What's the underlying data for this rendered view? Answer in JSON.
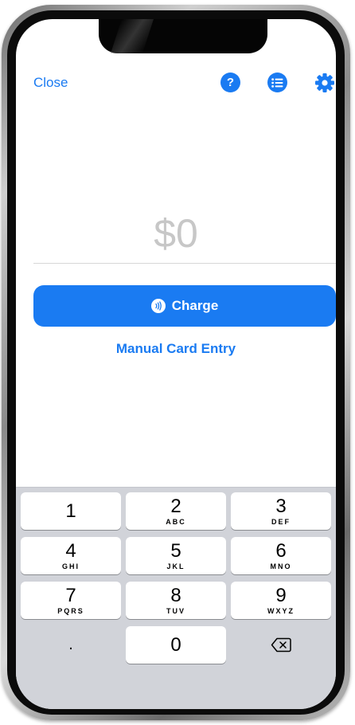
{
  "topbar": {
    "close_label": "Close",
    "help_icon_glyph": "?",
    "icons": [
      "help-icon",
      "list-icon",
      "gear-icon"
    ]
  },
  "amount": {
    "value": "$0"
  },
  "actions": {
    "charge_label": "Charge",
    "manual_label": "Manual Card Entry"
  },
  "keypad": {
    "keys": [
      {
        "digit": "1",
        "letters": ""
      },
      {
        "digit": "2",
        "letters": "ABC"
      },
      {
        "digit": "3",
        "letters": "DEF"
      },
      {
        "digit": "4",
        "letters": "GHI"
      },
      {
        "digit": "5",
        "letters": "JKL"
      },
      {
        "digit": "6",
        "letters": "MNO"
      },
      {
        "digit": "7",
        "letters": "PQRS"
      },
      {
        "digit": "8",
        "letters": "TUV"
      },
      {
        "digit": "9",
        "letters": "WXYZ"
      },
      {
        "digit": "0",
        "letters": ""
      }
    ],
    "decimal": ".",
    "delete_icon": "backspace-icon"
  },
  "colors": {
    "accent": "#1a7bf2",
    "keyboard_bg": "#d1d3d9",
    "amount_placeholder": "#c7c7c7"
  }
}
